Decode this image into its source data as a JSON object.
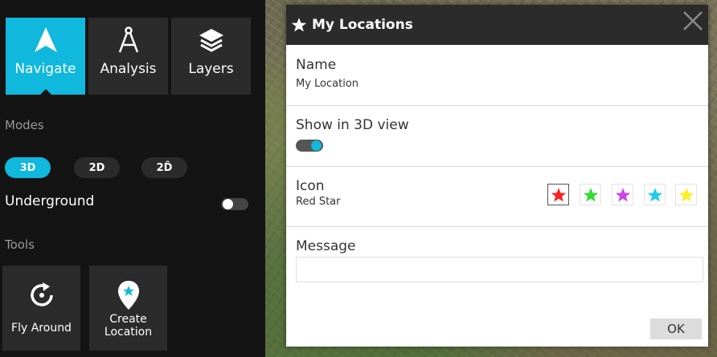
{
  "panel": {
    "tabs": [
      {
        "label": "Navigate",
        "icon": "navigate-arrow-icon",
        "active": true
      },
      {
        "label": "Analysis",
        "icon": "compass-icon",
        "active": false
      },
      {
        "label": "Layers",
        "icon": "layers-icon",
        "active": false
      }
    ],
    "modes_title": "Modes",
    "modes": [
      {
        "label": "3D",
        "active": true
      },
      {
        "label": "2D",
        "active": false
      },
      {
        "label": "2D̂",
        "active": false
      }
    ],
    "underground_label": "Underground",
    "underground_on": false,
    "tools_title": "Tools",
    "tools": [
      {
        "label": "Fly Around",
        "icon": "rotate-icon"
      },
      {
        "label": "Create\nLocation",
        "icon": "location-pin-icon"
      }
    ]
  },
  "dialog": {
    "title": "My Locations",
    "title_icon": "star-icon",
    "name_label": "Name",
    "name_value": "My Location",
    "show3d_label": "Show in 3D view",
    "show3d_on": true,
    "icon_label": "Icon",
    "icon_value": "Red Star",
    "icon_options": [
      {
        "name": "red-star",
        "color": "#ff2020",
        "selected": true
      },
      {
        "name": "green-star",
        "color": "#33dd33",
        "selected": false
      },
      {
        "name": "purple-star",
        "color": "#cc44ee",
        "selected": false
      },
      {
        "name": "cyan-star",
        "color": "#22ccee",
        "selected": false
      },
      {
        "name": "yellow-star",
        "color": "#ffee22",
        "selected": false
      }
    ],
    "message_label": "Message",
    "message_value": "",
    "ok_label": "OK"
  },
  "colors": {
    "accent": "#0fb8dc",
    "panel_bg": "#141414",
    "tile_bg": "#2b2b2b"
  }
}
